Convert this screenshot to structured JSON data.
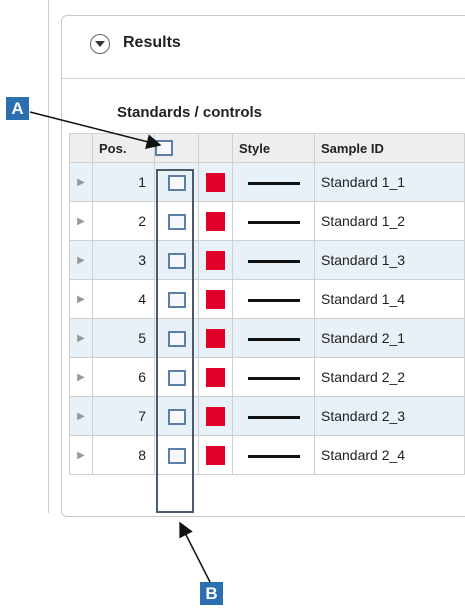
{
  "panel": {
    "title": "Results"
  },
  "section": {
    "title": "Standards / controls"
  },
  "table": {
    "headers": {
      "pos": "Pos.",
      "style": "Style",
      "sample_id": "Sample ID"
    },
    "rows": [
      {
        "pos": "1",
        "sample_id": "Standard 1_1"
      },
      {
        "pos": "2",
        "sample_id": "Standard 1_2"
      },
      {
        "pos": "3",
        "sample_id": "Standard 1_3"
      },
      {
        "pos": "4",
        "sample_id": "Standard 1_4"
      },
      {
        "pos": "5",
        "sample_id": "Standard 2_1"
      },
      {
        "pos": "6",
        "sample_id": "Standard 2_2"
      },
      {
        "pos": "7",
        "sample_id": "Standard 2_3"
      },
      {
        "pos": "8",
        "sample_id": "Standard 2_4"
      }
    ]
  },
  "callouts": {
    "a": "A",
    "b": "B"
  },
  "colors": {
    "swatch": "#e0002a",
    "callout": "#2c6fb0",
    "row_alt": "#e8f0f8"
  }
}
